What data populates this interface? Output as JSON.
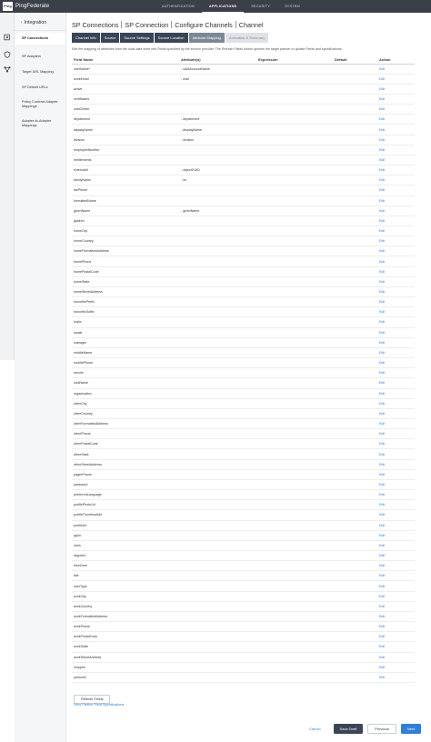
{
  "brand": {
    "logo_mark": "Ping",
    "name": "PingFederate"
  },
  "topnav": {
    "items": [
      {
        "label": "AUTHENTICATION"
      },
      {
        "label": "APPLICATIONS"
      },
      {
        "label": "SECURITY"
      },
      {
        "label": "SYSTEM"
      }
    ],
    "active": "APPLICATIONS"
  },
  "iconstrip": {
    "icons": [
      "applications-icon",
      "shield-icon",
      "share-icon"
    ]
  },
  "sidebar": {
    "title": "Integration",
    "items": [
      {
        "label": "SP Connections",
        "active": true
      },
      {
        "label": "SP Adapters"
      },
      {
        "label": "Target URL Mapping"
      },
      {
        "label": "SP Default URLs"
      },
      {
        "label": "Policy Contract Adapter Mappings"
      },
      {
        "label": "Adapter-to-Adapter Mappings"
      }
    ]
  },
  "breadcrumb": [
    "SP Connections",
    "SP Connection",
    "Configure Channels",
    "Channel"
  ],
  "tabs": [
    {
      "label": "Channel Info",
      "state": "normal"
    },
    {
      "label": "Source",
      "state": "normal"
    },
    {
      "label": "Source Settings",
      "state": "normal"
    },
    {
      "label": "Source Location",
      "state": "normal"
    },
    {
      "label": "Attribute Mapping",
      "state": "active"
    },
    {
      "label": "Activation & Summary",
      "state": "disabled"
    }
  ],
  "description": "Edit the mapping of attributes from the local data store into Fields specified by the service provider. The Refresh Fields button queries the target partner to update Fields and specifications.",
  "table": {
    "headers": [
      "Field Name",
      "Attribute(s)",
      "Expression",
      "Default",
      "Action"
    ],
    "rows": [
      {
        "field": "userName*",
        "attr": "- sAMAccountName",
        "action": "Edit"
      },
      {
        "field": "workEmail",
        "attr": "- mail",
        "action": "Edit"
      },
      {
        "field": "active",
        "attr": "",
        "action": "Edit"
      },
      {
        "field": "certificates",
        "attr": "",
        "action": "Edit"
      },
      {
        "field": "costCenter",
        "attr": "",
        "action": "Edit"
      },
      {
        "field": "department",
        "attr": "- department",
        "action": "Edit"
      },
      {
        "field": "displayName",
        "attr": "- displayName",
        "action": "Edit"
      },
      {
        "field": "division",
        "attr": "- division",
        "action": "Edit"
      },
      {
        "field": "employeeNumber",
        "attr": "",
        "action": "Edit"
      },
      {
        "field": "entitlements",
        "attr": "",
        "action": "Edit"
      },
      {
        "field": "externalId",
        "attr": "- objectGUID",
        "action": "Edit"
      },
      {
        "field": "familyName",
        "attr": "- sn",
        "action": "Edit"
      },
      {
        "field": "faxPhone",
        "attr": "",
        "action": "Edit"
      },
      {
        "field": "formattedName",
        "attr": "",
        "action": "Edit"
      },
      {
        "field": "givenName",
        "attr": "- givenName",
        "action": "Edit"
      },
      {
        "field": "gtalkIm",
        "attr": "",
        "action": "Edit"
      },
      {
        "field": "homeCity",
        "attr": "",
        "action": "Edit"
      },
      {
        "field": "homeCountry",
        "attr": "",
        "action": "Edit"
      },
      {
        "field": "homeFormattedAddress",
        "attr": "",
        "action": "Edit"
      },
      {
        "field": "homePhone",
        "attr": "",
        "action": "Edit"
      },
      {
        "field": "homePostalCode",
        "attr": "",
        "action": "Edit"
      },
      {
        "field": "homeState",
        "attr": "",
        "action": "Edit"
      },
      {
        "field": "homeStreetAddress",
        "attr": "",
        "action": "Edit"
      },
      {
        "field": "honorificPrefix",
        "attr": "",
        "action": "Edit"
      },
      {
        "field": "honorificSuffix",
        "attr": "",
        "action": "Edit"
      },
      {
        "field": "icqIm",
        "attr": "",
        "action": "Edit"
      },
      {
        "field": "locale",
        "attr": "",
        "action": "Edit"
      },
      {
        "field": "manager",
        "attr": "",
        "action": "Edit"
      },
      {
        "field": "middleName",
        "attr": "",
        "action": "Edit"
      },
      {
        "field": "mobilePhone",
        "attr": "",
        "action": "Edit"
      },
      {
        "field": "msnIm",
        "attr": "",
        "action": "Edit"
      },
      {
        "field": "nickName",
        "attr": "",
        "action": "Edit"
      },
      {
        "field": "organization",
        "attr": "",
        "action": "Edit"
      },
      {
        "field": "otherCity",
        "attr": "",
        "action": "Edit"
      },
      {
        "field": "otherCountry",
        "attr": "",
        "action": "Edit"
      },
      {
        "field": "otherFormattedAddress",
        "attr": "",
        "action": "Edit"
      },
      {
        "field": "otherPhone",
        "attr": "",
        "action": "Edit"
      },
      {
        "field": "otherPostalCode",
        "attr": "",
        "action": "Edit"
      },
      {
        "field": "otherState",
        "attr": "",
        "action": "Edit"
      },
      {
        "field": "otherStreetAddress",
        "attr": "",
        "action": "Edit"
      },
      {
        "field": "pagerPhone",
        "attr": "",
        "action": "Edit"
      },
      {
        "field": "password",
        "attr": "",
        "action": "Edit"
      },
      {
        "field": "preferredLanguage",
        "attr": "",
        "action": "Edit"
      },
      {
        "field": "profilePhotoUrl",
        "attr": "",
        "action": "Edit"
      },
      {
        "field": "profileThumbnailUrl",
        "attr": "",
        "action": "Edit"
      },
      {
        "field": "profileUrl",
        "attr": "",
        "action": "Edit"
      },
      {
        "field": "qqIm",
        "attr": "",
        "action": "Edit"
      },
      {
        "field": "roles",
        "attr": "",
        "action": "Edit"
      },
      {
        "field": "skypeIm",
        "attr": "",
        "action": "Edit"
      },
      {
        "field": "timeZone",
        "attr": "",
        "action": "Edit"
      },
      {
        "field": "title",
        "attr": "",
        "action": "Edit"
      },
      {
        "field": "userType",
        "attr": "",
        "action": "Edit"
      },
      {
        "field": "workCity",
        "attr": "",
        "action": "Edit"
      },
      {
        "field": "workCountry",
        "attr": "",
        "action": "Edit"
      },
      {
        "field": "workFormattedAddress",
        "attr": "",
        "action": "Edit"
      },
      {
        "field": "workPhone",
        "attr": "",
        "action": "Edit"
      },
      {
        "field": "workPostalCode",
        "attr": "",
        "action": "Edit"
      },
      {
        "field": "workState",
        "attr": "",
        "action": "Edit"
      },
      {
        "field": "workStreetAddress",
        "attr": "",
        "action": "Edit"
      },
      {
        "field": "xmppIm",
        "attr": "",
        "action": "Edit"
      },
      {
        "field": "yahooIm",
        "attr": "",
        "action": "Edit"
      }
    ]
  },
  "refresh_label": "Refresh Fields",
  "partner_spec_label": "View Partner Field Specifications",
  "footer": {
    "cancel": "Cancel",
    "save_draft": "Save Draft",
    "previous": "Previous",
    "next": "Next"
  },
  "colors": {
    "topbar": "#3a3f48",
    "tab": "#3a4657",
    "tab_active": "#7b8795",
    "link": "#2f7fd8",
    "primary": "#2f7fd8"
  }
}
